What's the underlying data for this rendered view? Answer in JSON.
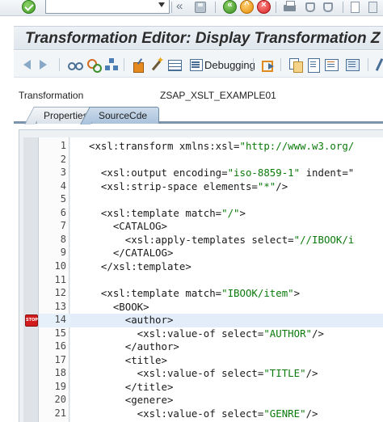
{
  "window": {
    "title": "Transformation Editor: Display Transformation Z"
  },
  "system_toolbar": {
    "command_field_value": "",
    "icons": [
      "ok-check-icon",
      "command-dropdown-icon",
      "double-chevron-icon",
      "save-icon",
      "back-icon",
      "exit-icon",
      "cancel-icon",
      "print-icon",
      "find-icon",
      "find-next-icon",
      "first-page-icon",
      "previous-page-icon"
    ]
  },
  "app_toolbar": {
    "debugging_label": "Debugging",
    "icons": [
      "back-arrow-icon",
      "forward-arrow-icon",
      "display-change-icon",
      "check-icon",
      "hierarchy-icon",
      "activate-icon",
      "test-wand-icon",
      "table-icon",
      "debugging-icon",
      "export-icon",
      "copy-icon",
      "document-icon",
      "documentation-icon",
      "settings-icon",
      "more-icon"
    ]
  },
  "transformation": {
    "label": "Transformation",
    "value": "ZSAP_XSLT_EXAMPLE01"
  },
  "tabs": [
    {
      "label": "Properties",
      "active": false
    },
    {
      "label": "SourceCde",
      "active": true
    }
  ],
  "editor": {
    "current_line": 14,
    "breakpoint_line": 14,
    "lines": [
      {
        "no": "1",
        "pre": "<xsl:transform xmlns:xsl=",
        "q": "\"http://www.w3.org/",
        "post": ""
      },
      {
        "no": "2",
        "pre": "",
        "q": "",
        "post": ""
      },
      {
        "no": "3",
        "pre": "  <xsl:output encoding=",
        "q": "\"iso-8859-1\"",
        "post": " indent=\""
      },
      {
        "no": "4",
        "pre": "  <xsl:strip-space elements=",
        "q": "\"*\"",
        "post": "/>"
      },
      {
        "no": "5",
        "pre": "",
        "q": "",
        "post": ""
      },
      {
        "no": "6",
        "pre": "  <xsl:template match=",
        "q": "\"/\"",
        "post": ">"
      },
      {
        "no": "7",
        "pre": "    <CATALOG>",
        "q": "",
        "post": ""
      },
      {
        "no": "8",
        "pre": "      <xsl:apply-templates select=",
        "q": "\"//IBOOK/i",
        "post": ""
      },
      {
        "no": "9",
        "pre": "    </CATALOG>",
        "q": "",
        "post": ""
      },
      {
        "no": "10",
        "pre": "  </xsl:template>",
        "q": "",
        "post": ""
      },
      {
        "no": "11",
        "pre": "",
        "q": "",
        "post": ""
      },
      {
        "no": "12",
        "pre": "  <xsl:template match=",
        "q": "\"IBOOK/item\"",
        "post": ">"
      },
      {
        "no": "13",
        "pre": "    <BOOK>",
        "q": "",
        "post": ""
      },
      {
        "no": "14",
        "pre": "      <author>",
        "q": "",
        "post": ""
      },
      {
        "no": "15",
        "pre": "        <xsl:value-of select=",
        "q": "\"AUTHOR\"",
        "post": "/>"
      },
      {
        "no": "16",
        "pre": "      </author>",
        "q": "",
        "post": ""
      },
      {
        "no": "17",
        "pre": "      <title>",
        "q": "",
        "post": ""
      },
      {
        "no": "18",
        "pre": "        <xsl:value-of select=",
        "q": "\"TITLE\"",
        "post": "/>"
      },
      {
        "no": "19",
        "pre": "      </title>",
        "q": "",
        "post": ""
      },
      {
        "no": "20",
        "pre": "      <genere>",
        "q": "",
        "post": ""
      },
      {
        "no": "21",
        "pre": "        <xsl:value-of select=",
        "q": "\"GENRE\"",
        "post": "/>"
      }
    ]
  },
  "colors": {
    "string_literal": "#0a7a0a",
    "breakpoint": "#d21c1c",
    "active_tab": "#a9c2dc"
  }
}
